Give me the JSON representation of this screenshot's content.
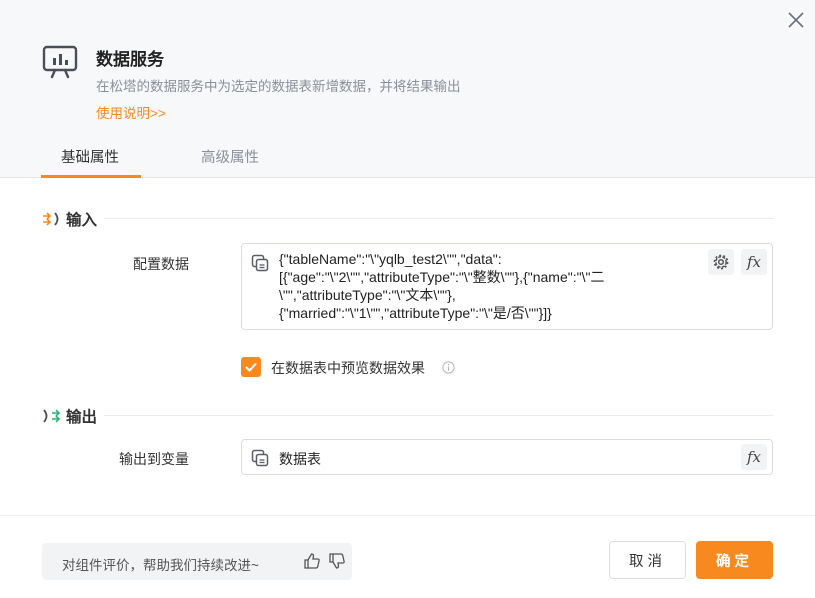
{
  "dialog": {
    "title": "数据服务",
    "subtitle": "在松塔的数据服务中为选定的数据表新增数据，并将结果输出",
    "help_link": "使用说明>>",
    "icons": {
      "app": "presentation-chart-icon",
      "close": "close-icon"
    }
  },
  "tabs": [
    {
      "label": "基础属性",
      "active": true
    },
    {
      "label": "高级属性",
      "active": false
    }
  ],
  "accent_color": "#f7891f",
  "input_section": {
    "title": "输入",
    "config_label": "配置数据",
    "config_value": "{\"tableName\":\"\\\"yqlb_test2\\\"\",\"data\":\n[{\"age\":\"\\\"2\\\"\",\"attributeType\":\"\\\"整数\\\"\"},{\"name\":\"\\\"二\n\\\"\",\"attributeType\":\"\\\"文本\\\"\"},\n{\"married\":\"\\\"1\\\"\",\"attributeType\":\"\\\"是/否\\\"\"}]}",
    "fx_label": "fx",
    "preview_checkbox": {
      "label": "在数据表中预览数据效果",
      "checked": true
    }
  },
  "output_section": {
    "title": "输出",
    "var_label": "输出到变量",
    "var_value": "数据表",
    "fx_label": "fx"
  },
  "footer": {
    "feedback_text": "对组件评价，帮助我们持续改进~",
    "cancel_label": "取消",
    "ok_label": "确定"
  }
}
